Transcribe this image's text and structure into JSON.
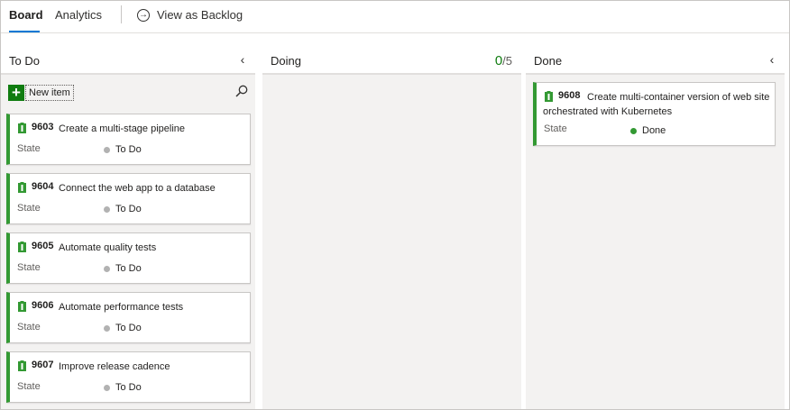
{
  "tabs": {
    "board": "Board",
    "analytics": "Analytics",
    "view_as_backlog": "View as Backlog"
  },
  "columns": {
    "todo": {
      "title": "To Do",
      "new_item_label": "New item"
    },
    "doing": {
      "title": "Doing",
      "wip_current": "0",
      "wip_limit": "/5"
    },
    "done": {
      "title": "Done"
    }
  },
  "cards": {
    "todo": [
      {
        "id": "9603",
        "title": "Create a multi-stage pipeline",
        "state_label": "State",
        "state": "To Do"
      },
      {
        "id": "9604",
        "title": "Connect the web app to a database",
        "state_label": "State",
        "state": "To Do"
      },
      {
        "id": "9605",
        "title": "Automate quality tests",
        "state_label": "State",
        "state": "To Do"
      },
      {
        "id": "9606",
        "title": "Automate performance tests",
        "state_label": "State",
        "state": "To Do"
      },
      {
        "id": "9607",
        "title": "Improve release cadence",
        "state_label": "State",
        "state": "To Do"
      }
    ],
    "done": [
      {
        "id": "9608",
        "title": "Create multi-container version of web site orchestrated with Kubernetes",
        "state_label": "State",
        "state": "Done"
      }
    ]
  },
  "icons": {
    "collapse": "chevron-left-icon",
    "search": "search-icon",
    "add": "plus-icon",
    "work_item": "product-backlog-item-icon",
    "backlog": "arrow-circle-icon"
  },
  "colors": {
    "accent": "#0078d4",
    "work_item_green": "#339933",
    "add_button_green": "#107c10",
    "todo_dot": "#b2b2b2",
    "done_dot": "#339933"
  }
}
